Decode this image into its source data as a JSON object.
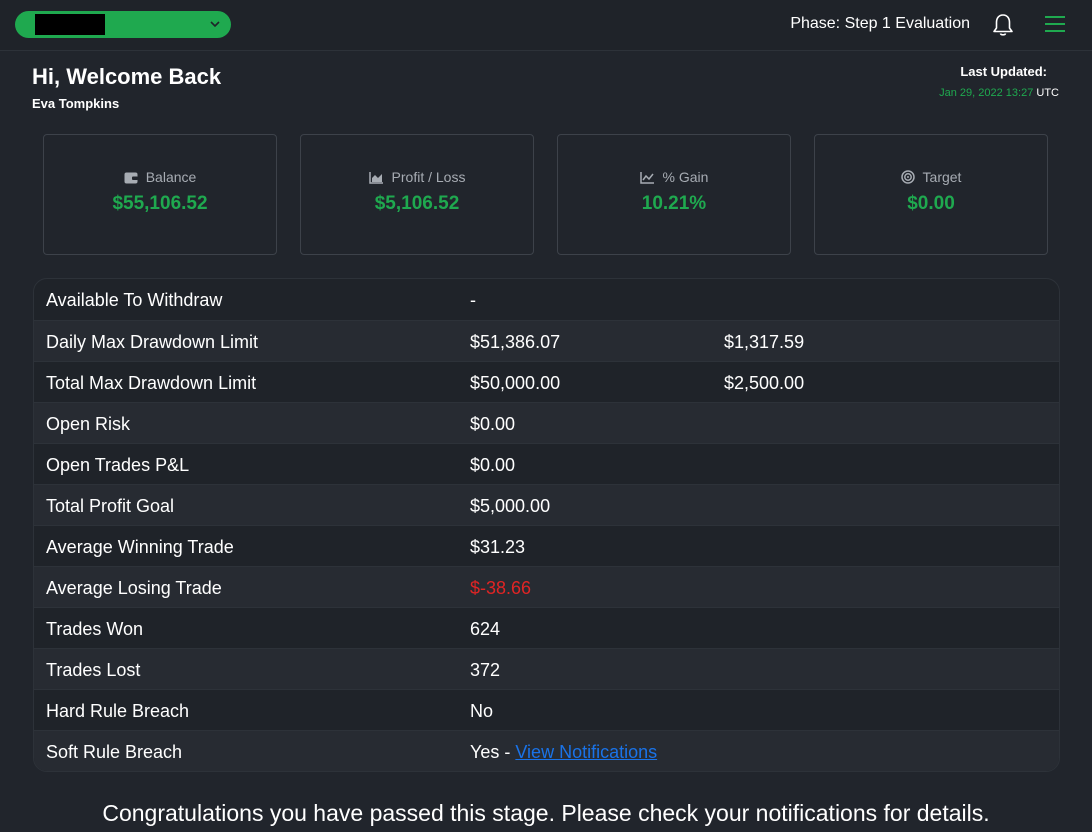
{
  "header": {
    "account_selected": "",
    "phase": "Phase: Step 1 Evaluation"
  },
  "welcome": {
    "title": "Hi, Welcome Back",
    "name": "Eva Tompkins"
  },
  "last_updated": {
    "label": "Last Updated:",
    "datetime": "Jan 29, 2022 13:27",
    "timezone": "UTC"
  },
  "cards": [
    {
      "label": "Balance",
      "value": "$55,106.52",
      "icon": "wallet-icon"
    },
    {
      "label": "Profit / Loss",
      "value": "$5,106.52",
      "icon": "area-chart-icon"
    },
    {
      "label": "% Gain",
      "value": "10.21%",
      "icon": "line-chart-icon"
    },
    {
      "label": "Target",
      "value": "$0.00",
      "icon": "target-icon"
    }
  ],
  "stats": [
    {
      "label": "Available To Withdraw",
      "value": "-",
      "extra": ""
    },
    {
      "label": "Daily Max Drawdown Limit",
      "value": "$51,386.07",
      "extra": "$1,317.59"
    },
    {
      "label": "Total Max Drawdown Limit",
      "value": "$50,000.00",
      "extra": "$2,500.00"
    },
    {
      "label": "Open Risk",
      "value": "$0.00",
      "extra": ""
    },
    {
      "label": "Open Trades P&L",
      "value": "$0.00",
      "extra": ""
    },
    {
      "label": "Total Profit Goal",
      "value": "$5,000.00",
      "extra": ""
    },
    {
      "label": "Average Winning Trade",
      "value": "$31.23",
      "extra": ""
    },
    {
      "label": "Average Losing Trade",
      "value": "$-38.66",
      "extra": ""
    },
    {
      "label": "Trades Won",
      "value": "624",
      "extra": ""
    },
    {
      "label": "Trades Lost",
      "value": "372",
      "extra": ""
    },
    {
      "label": "Hard Rule Breach",
      "value": "No",
      "extra": ""
    },
    {
      "label": "Soft Rule Breach",
      "value": "Yes - ",
      "link": "View Notifications"
    }
  ],
  "message": "Congratulations you have passed this stage. Please check your notifications for details.",
  "colors": {
    "accent": "#1fa94f",
    "negative": "#e02424",
    "link": "#1a73e8",
    "background": "#21252c"
  }
}
